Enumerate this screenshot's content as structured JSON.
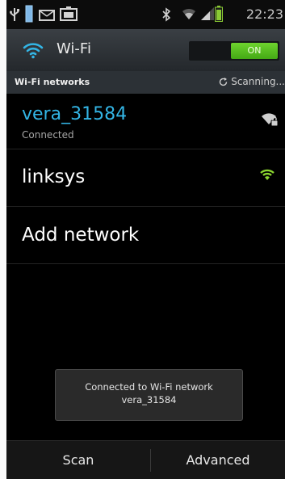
{
  "status_bar": {
    "time": "22:23",
    "icons": [
      "usb-icon",
      "battery-small-icon",
      "mail-icon",
      "gallery-icon",
      "bluetooth-icon",
      "wifi-status-icon",
      "signal-icon",
      "battery-icon"
    ]
  },
  "title_bar": {
    "title": "Wi-Fi",
    "toggle_label": "ON"
  },
  "section": {
    "title": "Wi-Fi networks",
    "scanning": "Scanning..."
  },
  "networks": [
    {
      "name": "vera_31584",
      "status": "Connected",
      "signal_icon": "wifi-secured-icon"
    },
    {
      "name": "linksys",
      "status": "",
      "signal_icon": "wifi-open-icon"
    }
  ],
  "add_network": "Add network",
  "toast": {
    "line1": "Connected to Wi-Fi network",
    "line2": "vera_31584"
  },
  "bottom_bar": {
    "scan": "Scan",
    "advanced": "Advanced"
  },
  "colors": {
    "accent": "#33b5e5",
    "toggle_on": "#5cc21f",
    "signal_green": "#8bd630"
  }
}
